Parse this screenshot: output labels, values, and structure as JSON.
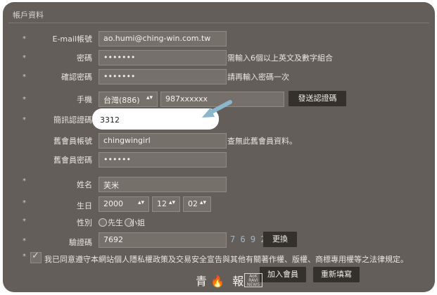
{
  "panel": {
    "title": "帳戶資料"
  },
  "fields": {
    "email": {
      "label": "E-mail帳號",
      "value": "ao.humi@ching-win.com.tw"
    },
    "password": {
      "label": "密碼",
      "value": "•••••••",
      "hint": "需輸入6個以上英文及數字組合"
    },
    "confirm_password": {
      "label": "確認密碼",
      "value": "•••••••",
      "hint": "請再輸入密碼一次"
    },
    "phone": {
      "label": "手機",
      "country": "台灣(886)",
      "number": "987xxxxxx",
      "send_code": "發送認證碼"
    },
    "sms_code": {
      "label": "簡訊認證碼",
      "value": "3312"
    },
    "old_account": {
      "label": "舊會員帳號",
      "value": "chingwingirl",
      "hint": "查無此舊會員資料。"
    },
    "old_password": {
      "label": "舊會員密碼",
      "value": "••••••"
    },
    "name": {
      "label": "姓名",
      "value": "芙米"
    },
    "birthday": {
      "label": "生日",
      "year": "2000",
      "month": "12",
      "day": "02"
    },
    "gender": {
      "label": "性別",
      "male": "先生",
      "female": "小姐"
    },
    "captcha": {
      "label": "驗證碼",
      "value": "7692",
      "image_text": "7 6 9 2",
      "refresh": "更換"
    }
  },
  "agreement": {
    "text": "我已同意遵守本網站個人隱私權政策及交易安全宣告與其他有關著作權、版權、商標專用權等之法律規定。"
  },
  "buttons": {
    "join": "加入會員",
    "reset": "重新填寫"
  },
  "logo": {
    "chars": [
      "青",
      "報"
    ],
    "badge": "AoK RAVI NEWS"
  },
  "colors": {
    "panel": "#635e59",
    "button": "#34302c",
    "highlight": "#ffffff",
    "arrow": "#8cb6cc"
  }
}
